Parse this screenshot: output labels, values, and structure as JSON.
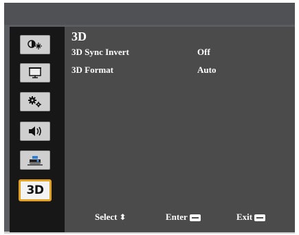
{
  "menu": {
    "title": "3D",
    "items": [
      {
        "label": "3D Sync Invert",
        "value": "Off"
      },
      {
        "label": "3D Format",
        "value": "Auto"
      }
    ]
  },
  "sidebar": {
    "icons": [
      {
        "name": "image-settings-icon",
        "selected": false
      },
      {
        "name": "display-icon",
        "selected": false
      },
      {
        "name": "setup-icon",
        "selected": false
      },
      {
        "name": "volume-icon",
        "selected": false
      },
      {
        "name": "options-icon",
        "selected": false
      },
      {
        "name": "3d-icon",
        "label": "3D",
        "selected": true
      }
    ]
  },
  "footer": {
    "select_label": "Select",
    "select_icon": "up-down-arrows-icon",
    "enter_label": "Enter",
    "enter_icon": "enter-key-icon",
    "exit_label": "Exit",
    "exit_icon": "menu-key-icon"
  },
  "colors": {
    "sidebar_bg": "#171717",
    "content_bg": "#4b4b4b",
    "selected_border": "#e5a21d",
    "frame_bg": "#5b5d60"
  }
}
